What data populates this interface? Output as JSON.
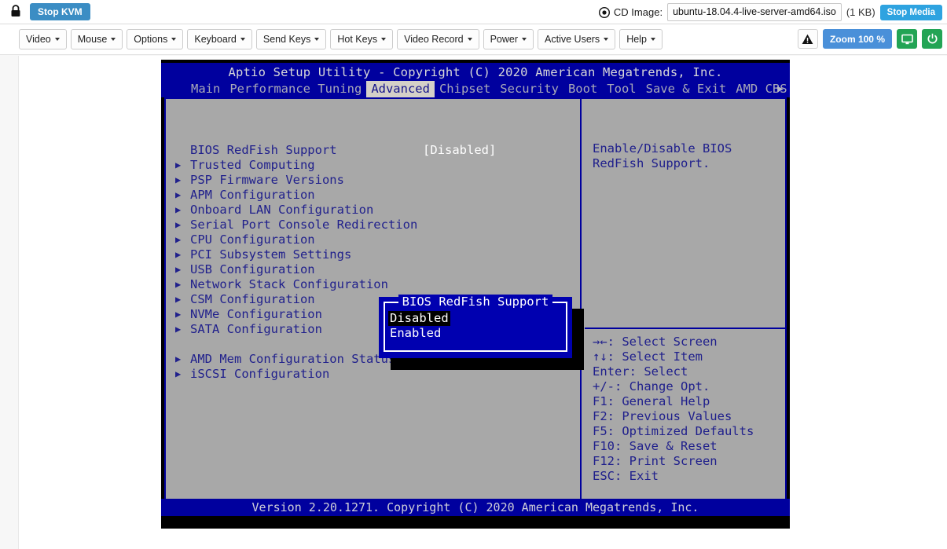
{
  "topbar": {
    "lock_icon": "lock-icon",
    "stop_kvm_label": "Stop KVM",
    "cd_icon": "cd-disc-icon",
    "cd_image_label": "CD Image:",
    "cd_image_value": "ubuntu-18.04.4-live-server-amd64.iso",
    "cd_image_size": "(1 KB)",
    "stop_media_label": "Stop Media"
  },
  "toolbar": {
    "menus": [
      {
        "label": "Video"
      },
      {
        "label": "Mouse"
      },
      {
        "label": "Options"
      },
      {
        "label": "Keyboard"
      },
      {
        "label": "Send Keys"
      },
      {
        "label": "Hot Keys"
      },
      {
        "label": "Video Record"
      },
      {
        "label": "Power"
      },
      {
        "label": "Active Users"
      },
      {
        "label": "Help"
      }
    ],
    "warning_icon": "warning-triangle-icon",
    "zoom_label": "Zoom 100 %",
    "display_icon": "monitor-icon",
    "power_icon": "power-icon",
    "accent_blue": "#4a90d9",
    "accent_green": "#23a455"
  },
  "bios": {
    "title": "Aptio Setup Utility - Copyright (C) 2020 American Megatrends, Inc.",
    "tabs": [
      {
        "label": "Main",
        "active": false
      },
      {
        "label": "Performance Tuning",
        "active": false
      },
      {
        "label": "Advanced",
        "active": true
      },
      {
        "label": "Chipset",
        "active": false
      },
      {
        "label": "Security",
        "active": false
      },
      {
        "label": "Boot",
        "active": false
      },
      {
        "label": "Tool",
        "active": false
      },
      {
        "label": "Save & Exit",
        "active": false
      },
      {
        "label": "AMD CBS",
        "active": false
      }
    ],
    "tab_scroll_arrow": "▶",
    "settings": [
      {
        "arrow": "",
        "label": "BIOS RedFish Support",
        "value": "[Disabled]"
      },
      {
        "arrow": "▶",
        "label": "Trusted Computing",
        "value": ""
      },
      {
        "arrow": "▶",
        "label": "PSP Firmware Versions",
        "value": ""
      },
      {
        "arrow": "▶",
        "label": "APM Configuration",
        "value": ""
      },
      {
        "arrow": "▶",
        "label": "Onboard LAN Configuration",
        "value": ""
      },
      {
        "arrow": "▶",
        "label": "Serial Port Console Redirection",
        "value": ""
      },
      {
        "arrow": "▶",
        "label": "CPU Configuration",
        "value": ""
      },
      {
        "arrow": "▶",
        "label": "PCI Subsystem Settings",
        "value": ""
      },
      {
        "arrow": "▶",
        "label": "USB Configuration",
        "value": ""
      },
      {
        "arrow": "▶",
        "label": "Network Stack Configuration",
        "value": ""
      },
      {
        "arrow": "▶",
        "label": "CSM Configuration",
        "value": ""
      },
      {
        "arrow": "▶",
        "label": "NVMe Configuration",
        "value": ""
      },
      {
        "arrow": "▶",
        "label": "SATA Configuration",
        "value": ""
      },
      {
        "arrow": "",
        "label": "",
        "value": ""
      },
      {
        "arrow": "▶",
        "label": "AMD Mem Configuration Status",
        "value": ""
      },
      {
        "arrow": "▶",
        "label": "iSCSI Configuration",
        "value": ""
      }
    ],
    "help_text": "Enable/Disable BIOS RedFish Support.",
    "key_help": [
      "→←: Select Screen",
      "↑↓: Select Item",
      "Enter: Select",
      "+/-: Change Opt.",
      "F1: General Help",
      "F2: Previous Values",
      "F5: Optimized Defaults",
      "F10: Save & Reset",
      "F12: Print Screen",
      "ESC: Exit"
    ],
    "footer": "Version 2.20.1271. Copyright (C) 2020 American Megatrends, Inc.",
    "popup": {
      "title": "BIOS RedFish Support",
      "options": [
        {
          "label": "Disabled",
          "selected": true
        },
        {
          "label": "Enabled",
          "selected": false
        }
      ]
    },
    "colors": {
      "screen_blue": "#00009e",
      "panel_grey": "#a8a8a8",
      "text_blue": "#20208c",
      "popup_blue": "#0000b0"
    }
  }
}
